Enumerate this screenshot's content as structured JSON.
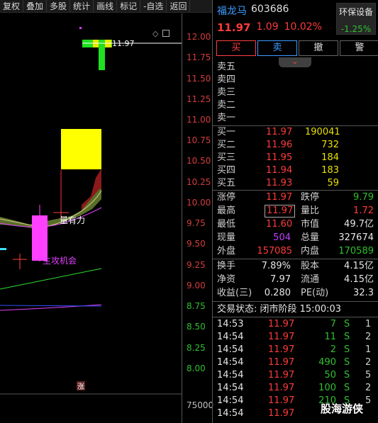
{
  "toolbar": {
    "items": [
      "复权",
      "叠加",
      "多股",
      "统计",
      "画线",
      "标记",
      "-自选",
      "返回"
    ]
  },
  "chart": {
    "price_axis": [
      "12.00",
      "11.75",
      "11.50",
      "11.25",
      "11.00",
      "10.75",
      "10.50",
      "10.25",
      "10.00",
      "9.75",
      "9.50",
      "9.25",
      "9.00",
      "8.75",
      "8.50",
      "8.25",
      "8.00"
    ],
    "volume_axis": "75000",
    "last_price_label": "11.97",
    "annotation_strength": "量有力",
    "annotation_opportunity": "主攻机会",
    "limit_marker": "涨"
  },
  "stock": {
    "name": "福龙马",
    "code": "603686",
    "price": "11.97",
    "change": "1.09",
    "change_pct": "10.02%"
  },
  "sector": {
    "name": "环保设备",
    "pct": "-1.25%"
  },
  "actions": {
    "buy": "买",
    "sell": "卖",
    "cancel": "撤",
    "alert": "警"
  },
  "asks": [
    {
      "label": "卖五",
      "price": "",
      "vol": ""
    },
    {
      "label": "卖四",
      "price": "",
      "vol": ""
    },
    {
      "label": "卖三",
      "price": "",
      "vol": ""
    },
    {
      "label": "卖二",
      "price": "",
      "vol": ""
    },
    {
      "label": "卖一",
      "price": "",
      "vol": ""
    }
  ],
  "bids": [
    {
      "label": "买一",
      "price": "11.97",
      "vol": "190041"
    },
    {
      "label": "买二",
      "price": "11.96",
      "vol": "732"
    },
    {
      "label": "买三",
      "price": "11.95",
      "vol": "184"
    },
    {
      "label": "买四",
      "price": "11.94",
      "vol": "183"
    },
    {
      "label": "买五",
      "price": "11.93",
      "vol": "59"
    }
  ],
  "stats": {
    "limit_up_label": "涨停",
    "limit_up": "11.97",
    "limit_down_label": "跌停",
    "limit_down": "9.79",
    "high_label": "最高",
    "high": "11.97",
    "vol_ratio_label": "量比",
    "vol_ratio": "1.72",
    "low_label": "最低",
    "low": "11.60",
    "mkt_cap_label": "市值",
    "mkt_cap": "49.7亿",
    "cur_vol_label": "现量",
    "cur_vol": "504",
    "total_vol_label": "总量",
    "total_vol": "327674",
    "outer_label": "外盘",
    "outer": "157085",
    "inner_label": "内盘",
    "inner": "170589",
    "turnover_label": "换手",
    "turnover": "7.89%",
    "equity_label": "股本",
    "equity": "4.15亿",
    "nav_label": "净资",
    "nav": "7.97",
    "float_label": "流通",
    "float": "4.15亿",
    "eps_label": "收益(三)",
    "eps": "0.280",
    "pe_label": "PE(动)",
    "pe": "32.3"
  },
  "trade_status": "交易状态: 闭市阶段 15:00:03",
  "ticks": [
    {
      "time": "14:53",
      "price": "11.97",
      "vol": "7",
      "side": "S",
      "n": "1"
    },
    {
      "time": "14:54",
      "price": "11.97",
      "vol": "11",
      "side": "S",
      "n": "2"
    },
    {
      "time": "14:54",
      "price": "11.97",
      "vol": "2",
      "side": "S",
      "n": "1"
    },
    {
      "time": "14:54",
      "price": "11.97",
      "vol": "490",
      "side": "S",
      "n": "2"
    },
    {
      "time": "14:54",
      "price": "11.97",
      "vol": "50",
      "side": "S",
      "n": "5"
    },
    {
      "time": "14:54",
      "price": "11.97",
      "vol": "100",
      "side": "S",
      "n": "2"
    },
    {
      "time": "14:54",
      "price": "11.97",
      "vol": "210",
      "side": "S",
      "n": "5"
    },
    {
      "time": "14:54",
      "price": "11.97",
      "vol": "",
      "side": "",
      "n": ""
    }
  ],
  "watermark": "股海游侠",
  "colors": {
    "up": "#ff3b3b",
    "down": "#30c030",
    "accent_blue": "#3e9bff",
    "background": "#000000"
  }
}
